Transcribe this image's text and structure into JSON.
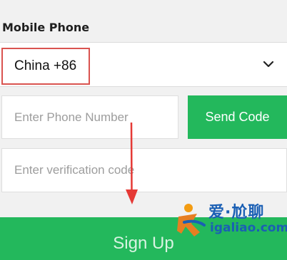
{
  "form": {
    "mobile_label": "Mobile Phone",
    "country_value": "China +86",
    "phone_placeholder": "Enter Phone Number",
    "send_code_label": "Send Code",
    "code_placeholder": "Enter verification code",
    "signup_label": "Sign Up"
  },
  "watermark": {
    "brand": "爱·尬聊",
    "domain": "igaliao.com"
  },
  "icons": {
    "country_dropdown": "chevron-down-icon",
    "annotation": "red-arrow-down",
    "watermark_logo": "running-figure-logo"
  },
  "colors": {
    "accent_green": "#23b85c",
    "highlight_red": "#d9534f",
    "watermark_blue": "#1a5fb4"
  }
}
